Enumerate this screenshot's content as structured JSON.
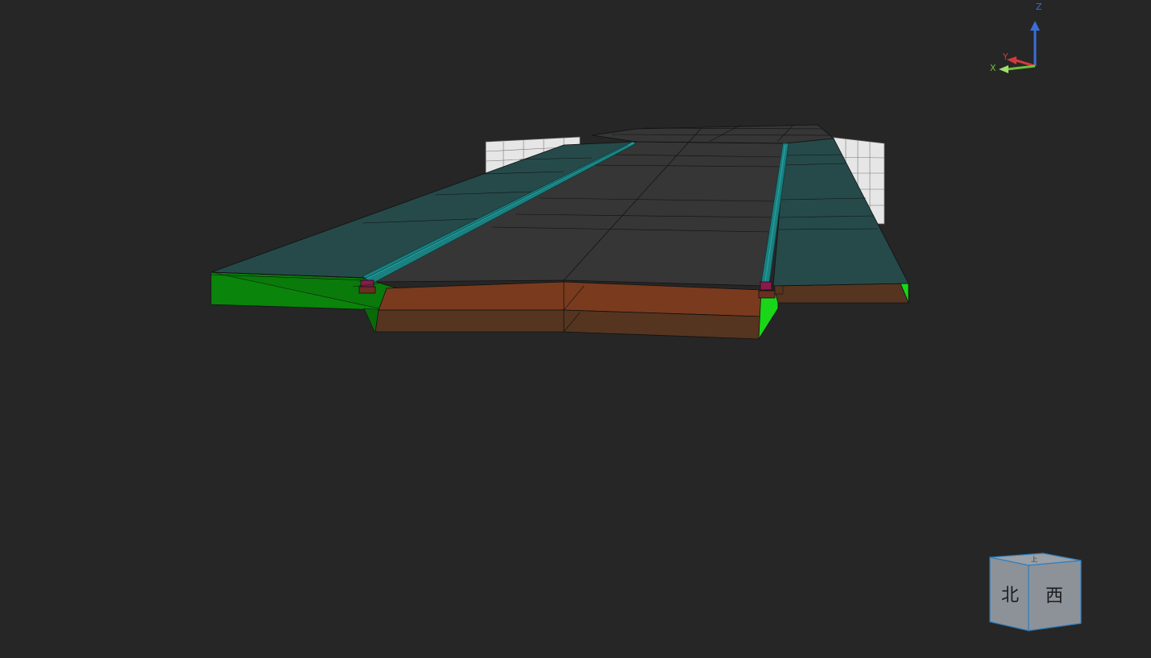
{
  "viewport": {
    "background": "#262626"
  },
  "axis_triad": {
    "x_label": "X",
    "y_label": "Y",
    "z_label": "Z",
    "x_color": "#6fbf3a",
    "y_color": "#d23a3a",
    "z_color": "#3a6fd8"
  },
  "view_cube": {
    "front_label": "北",
    "right_label": "西",
    "top_label": "上",
    "face_color": "#8d9299",
    "edge_color": "#2f7fbf"
  },
  "model": {
    "deck_color": "#363636",
    "slab_color": "#264a4a",
    "side_green": "#0a7a0a",
    "side_bright_green": "#19d619",
    "soil_orange": "#7a3a1e",
    "soil_brown": "#55351f",
    "rail_color": "#1a8080",
    "marker_color": "#8a1a4a",
    "wall_color": "#e6e6e6"
  }
}
